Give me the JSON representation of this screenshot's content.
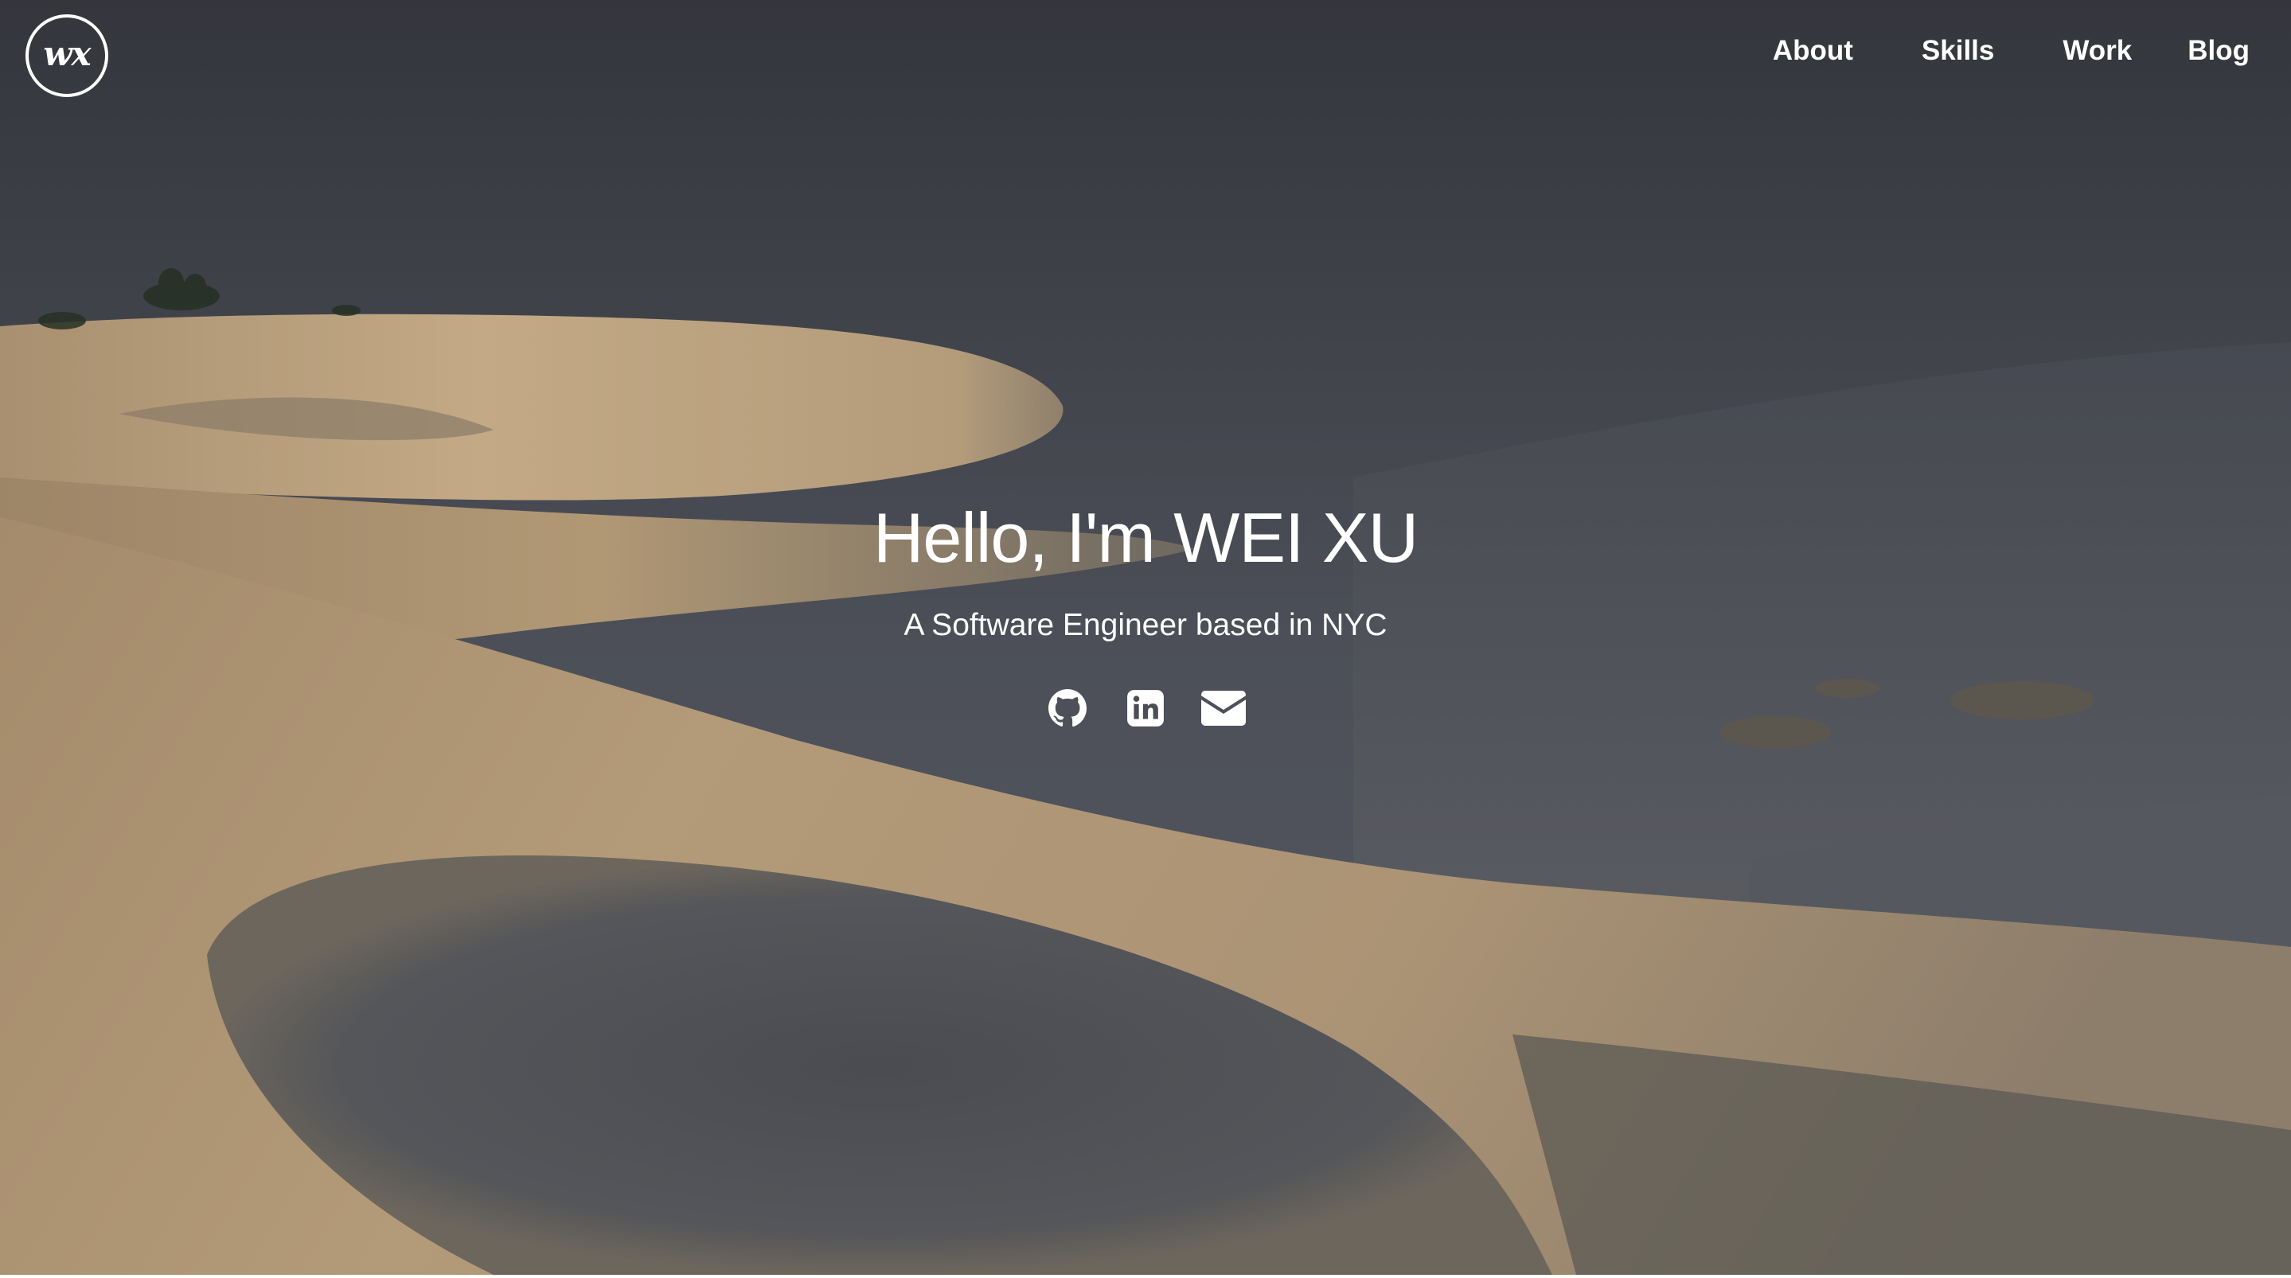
{
  "logo": {
    "text": "wx"
  },
  "nav": {
    "items": [
      {
        "label": "About"
      },
      {
        "label": "Skills"
      },
      {
        "label": "Work"
      },
      {
        "label": "Blog"
      }
    ]
  },
  "hero": {
    "title": "Hello, I'm WEI XU",
    "subtitle": "A Software Engineer based in NYC",
    "social": [
      {
        "icon": "github-icon"
      },
      {
        "icon": "linkedin-icon"
      },
      {
        "icon": "email-icon"
      }
    ]
  },
  "colors": {
    "text": "#ffffff",
    "sky": "#4a4d55",
    "sand_light": "#c7ad8a",
    "sand_shadow": "#4f525a"
  }
}
